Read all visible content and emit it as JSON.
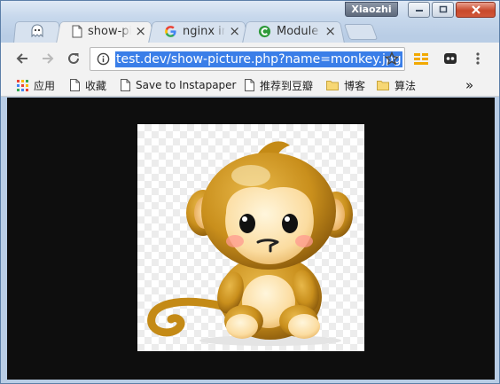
{
  "window": {
    "user_name": "Xiaozhi"
  },
  "tabs": [
    {
      "title": "show-picture",
      "icon": "document-icon",
      "active": true
    },
    {
      "title": "nginx index",
      "icon": "google-icon",
      "active": false
    },
    {
      "title": "Module",
      "icon": "green-c-icon",
      "active": false
    }
  ],
  "toolbar": {
    "url": "test.dev/show-picture.php?name=monkey.jpg"
  },
  "bookmarks": [
    {
      "label": "应用",
      "icon": "apps-grid-icon"
    },
    {
      "label": "收藏",
      "icon": "page-icon"
    },
    {
      "label": "Save to Instapaper",
      "icon": "page-icon"
    },
    {
      "label": "推荐到豆瓣",
      "icon": "page-icon"
    },
    {
      "label": "博客",
      "icon": "folder-icon"
    },
    {
      "label": "算法",
      "icon": "folder-icon"
    }
  ],
  "bookmarks_overflow": "»",
  "page": {
    "image_subject": "cartoon monkey",
    "background_color": "#0e0e0e"
  }
}
